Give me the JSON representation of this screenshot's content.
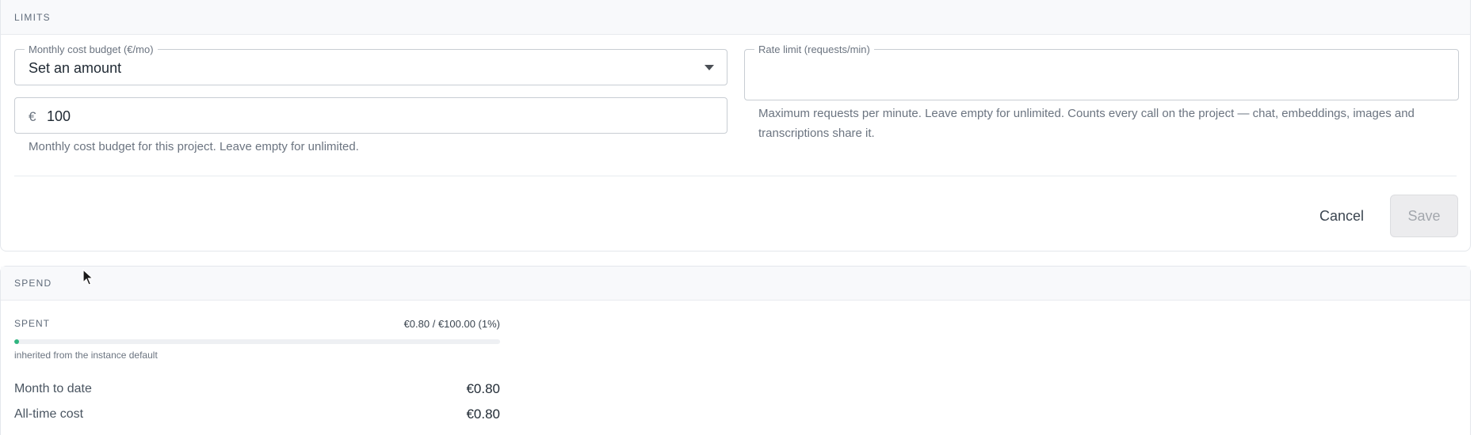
{
  "limits": {
    "header": "LIMITS",
    "budget": {
      "legend": "Monthly cost budget (€/mo)",
      "mode_value": "Set an amount",
      "currency": "€",
      "amount_value": "100",
      "helper": "Monthly cost budget for this project. Leave empty for unlimited."
    },
    "rate": {
      "legend": "Rate limit (requests/min)",
      "value": "",
      "helper": "Maximum requests per minute. Leave empty for unlimited. Counts every call on the project — chat, embeddings, images and transcriptions share it."
    },
    "cancel_label": "Cancel",
    "save_label": "Save"
  },
  "spend": {
    "header": "SPEND",
    "spent_label": "SPENT",
    "spent_value": "€0.80 / €100.00 (1%)",
    "spent_percent": 1,
    "inherited_note": "inherited from the instance default",
    "rows": [
      {
        "label": "Month to date",
        "value": "€0.80"
      },
      {
        "label": "All-time cost",
        "value": "€0.80"
      }
    ]
  },
  "colors": {
    "progress_fill": "#2fb57f",
    "header_bg": "#f8f9fb"
  }
}
